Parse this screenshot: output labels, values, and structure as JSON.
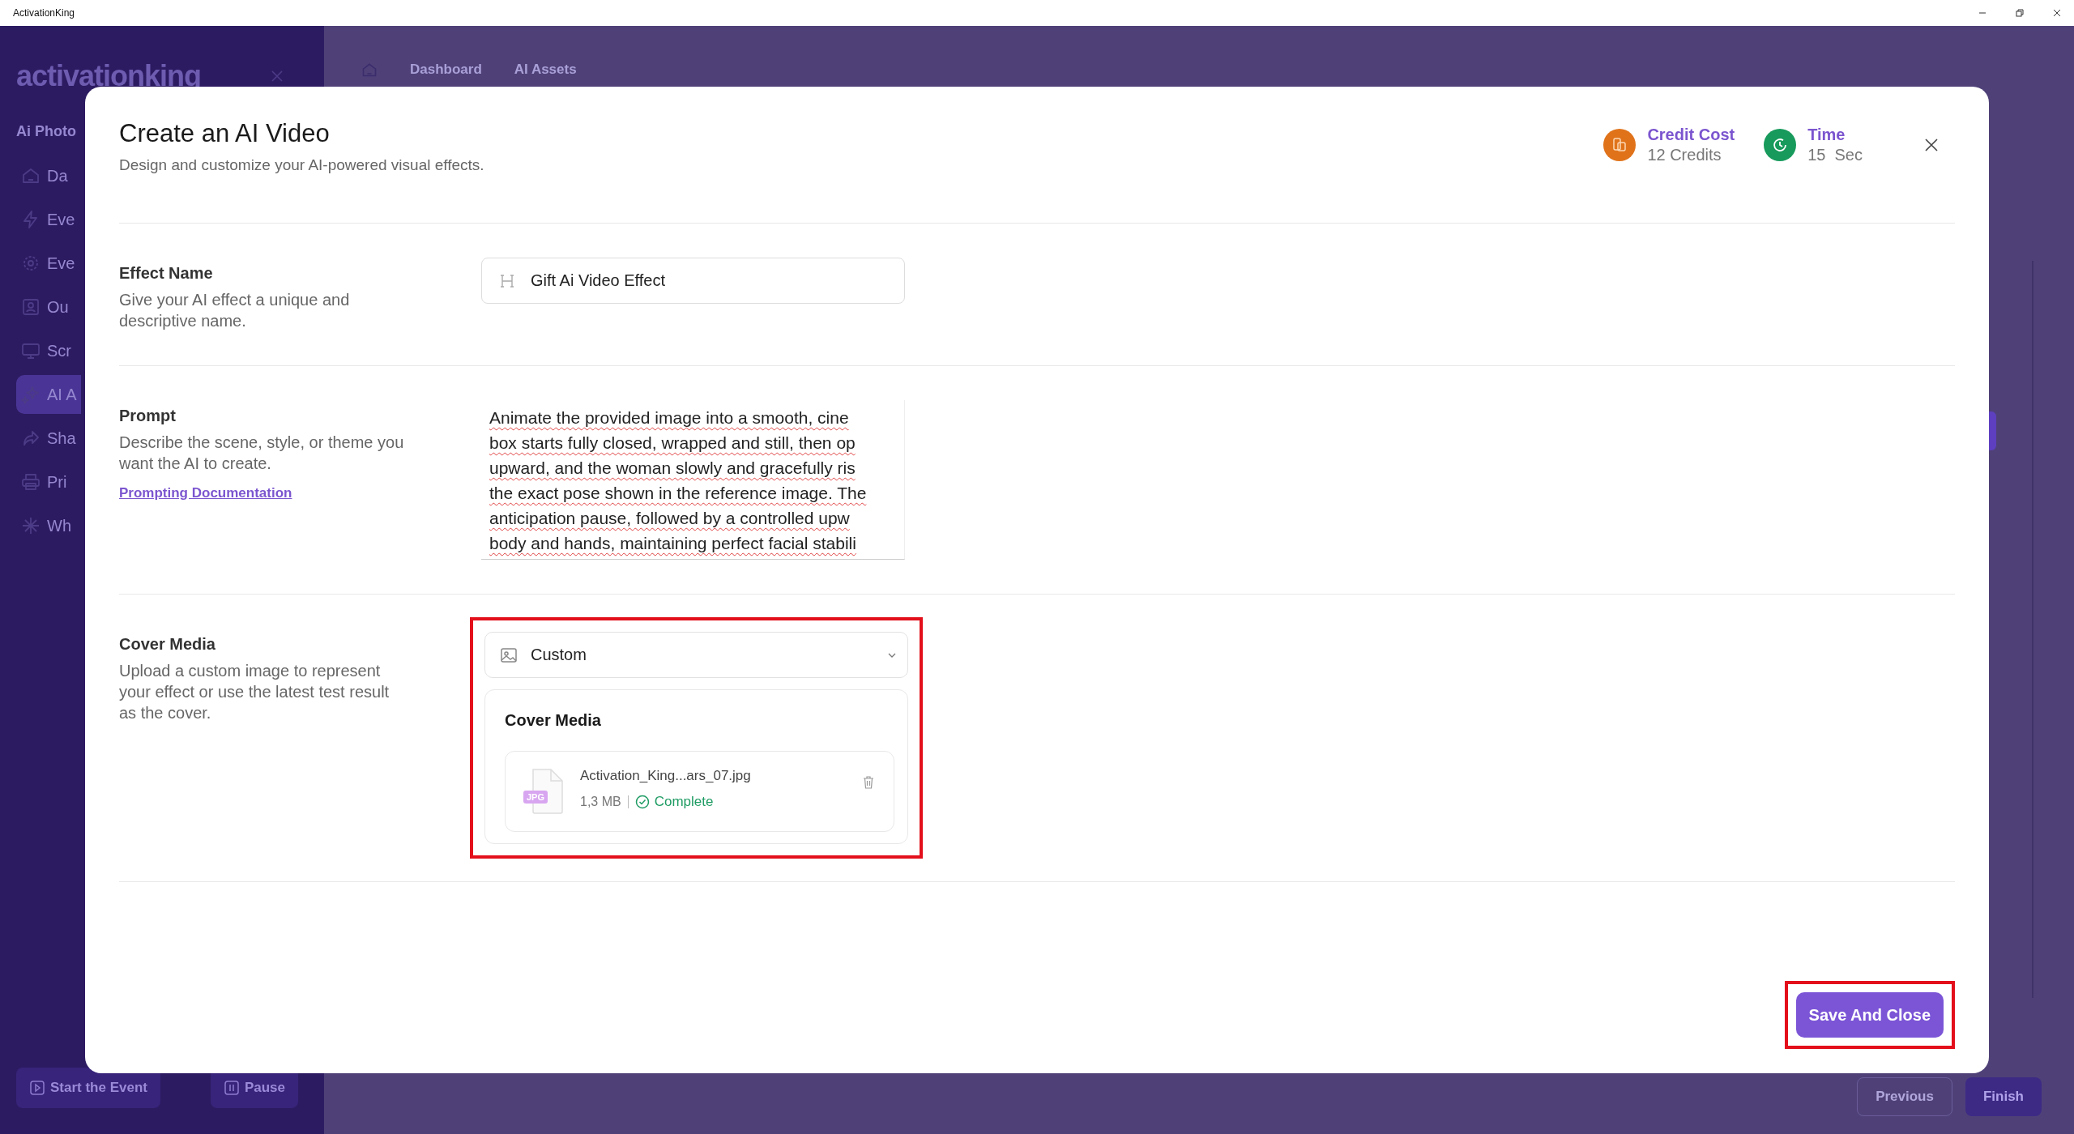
{
  "window": {
    "title": "ActivationKing"
  },
  "sidebar": {
    "logo": "activationking",
    "event_name": "Ai Photo",
    "items": [
      {
        "label": "Da",
        "selected": false
      },
      {
        "label": "Eve",
        "selected": false
      },
      {
        "label": "Eve",
        "selected": false
      },
      {
        "label": "Ou",
        "selected": false
      },
      {
        "label": "Scr",
        "selected": false
      },
      {
        "label": "AI A",
        "selected": true
      },
      {
        "label": "Sha",
        "selected": false
      },
      {
        "label": "Pri",
        "selected": false
      },
      {
        "label": "Wh",
        "selected": false
      }
    ],
    "actions": [
      "Start the Event",
      "Pause"
    ]
  },
  "breadcrumb": [
    "Dashboard",
    "AI Assets"
  ],
  "footer_buttons": [
    "Previous",
    "Finish"
  ],
  "modal": {
    "title": "Create an AI Video",
    "subtitle": "Design and customize your AI-powered visual effects.",
    "stats": [
      {
        "label": "Credit Cost",
        "value": "12 Credits",
        "color": "#e0731a"
      },
      {
        "label": "Time",
        "value": "15  Sec",
        "color": "#179a5b"
      }
    ],
    "effect_name": {
      "label": "Effect Name",
      "description": "Give your AI effect a unique and descriptive name.",
      "value": "Gift Ai Video Effect"
    },
    "prompt": {
      "label": "Prompt",
      "description": "Describe the scene, style, or theme you want the AI to create.",
      "link": "Prompting Documentation",
      "lines": [
        "Animate the provided image into a smooth, cine",
        "box starts fully closed, wrapped and still, then op",
        "upward, and the woman slowly and gracefully ris",
        "the exact pose shown in the reference image. The",
        "anticipation pause, followed by a controlled upw",
        "body and hands, maintaining perfect facial stabili"
      ]
    },
    "cover_media": {
      "label": "Cover Media",
      "description": "Upload a custom image to represent your effect or use the latest test result as the cover.",
      "select": "Custom",
      "card_title": "Cover Media",
      "highlighted": true,
      "file": {
        "badge": "JPG",
        "name": "Activation_King...ars_07.jpg",
        "size": "1,3 MB",
        "status": "Complete"
      }
    },
    "save_button": {
      "label": "Save And Close",
      "highlighted": true
    }
  }
}
